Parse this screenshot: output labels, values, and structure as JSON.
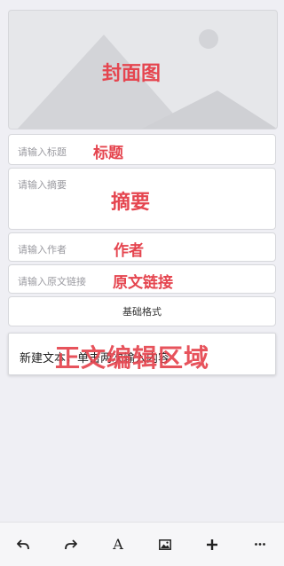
{
  "cover": {
    "overlay_label": "封面图"
  },
  "fields": [
    {
      "placeholder": "请输入标题",
      "overlay_label": "标题"
    },
    {
      "placeholder": "请输入摘要",
      "overlay_label": "摘要"
    },
    {
      "placeholder": "请输入作者",
      "overlay_label": "作者"
    },
    {
      "placeholder": "请输入原文链接",
      "overlay_label": "原文链接"
    }
  ],
  "format_button": {
    "label": "基础格式"
  },
  "editor": {
    "placeholder_text": "新建文本，单击两次输入内容",
    "overlay_label": "正文编辑区域"
  },
  "toolbar": {
    "items": [
      {
        "icon": "undo-icon"
      },
      {
        "icon": "redo-icon"
      },
      {
        "icon": "text-format-icon",
        "glyph": "A"
      },
      {
        "icon": "image-icon"
      },
      {
        "icon": "add-icon"
      },
      {
        "icon": "more-icon"
      }
    ]
  },
  "colors": {
    "annotation_red": "#e5454f",
    "background": "#efeff4"
  }
}
